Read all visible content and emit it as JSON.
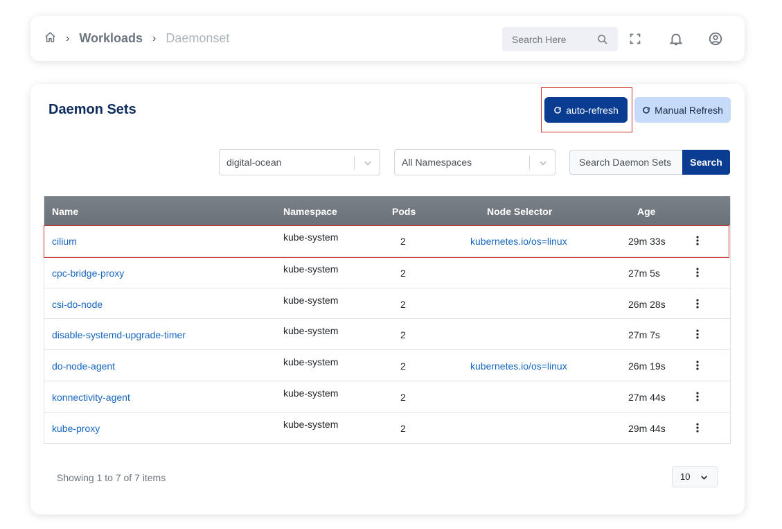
{
  "breadcrumb": {
    "level1": "Workloads",
    "level2": "Daemonset"
  },
  "topbar": {
    "search_placeholder": "Search Here"
  },
  "page": {
    "title": "Daemon Sets"
  },
  "toolbar": {
    "auto_refresh_label": "auto-refresh",
    "manual_refresh_label": "Manual Refresh"
  },
  "filters": {
    "cluster": "digital-ocean",
    "namespace": "All Namespaces",
    "search_placeholder": "Search Daemon Sets",
    "search_button": "Search"
  },
  "table": {
    "columns": [
      "Name",
      "Namespace",
      "Pods",
      "Node Selector",
      "Age"
    ],
    "rows": [
      {
        "name": "cilium",
        "namespace": "kube-system",
        "pods": "2",
        "selector": "kubernetes.io/os=linux",
        "age": "29m 33s"
      },
      {
        "name": "cpc-bridge-proxy",
        "namespace": "kube-system",
        "pods": "2",
        "selector": "",
        "age": "27m 5s"
      },
      {
        "name": "csi-do-node",
        "namespace": "kube-system",
        "pods": "2",
        "selector": "",
        "age": "26m 28s"
      },
      {
        "name": "disable-systemd-upgrade-timer",
        "namespace": "kube-system",
        "pods": "2",
        "selector": "",
        "age": "27m 7s"
      },
      {
        "name": "do-node-agent",
        "namespace": "kube-system",
        "pods": "2",
        "selector": "kubernetes.io/os=linux",
        "age": "26m 19s"
      },
      {
        "name": "konnectivity-agent",
        "namespace": "kube-system",
        "pods": "2",
        "selector": "",
        "age": "27m 44s"
      },
      {
        "name": "kube-proxy",
        "namespace": "kube-system",
        "pods": "2",
        "selector": "",
        "age": "29m 44s"
      }
    ]
  },
  "footer": {
    "showing": "Showing 1 to 7 of 7 items",
    "page_size": "10"
  },
  "colors": {
    "primary": "#0a3d91",
    "link": "#1565c0",
    "highlight": "#d32f2f"
  }
}
